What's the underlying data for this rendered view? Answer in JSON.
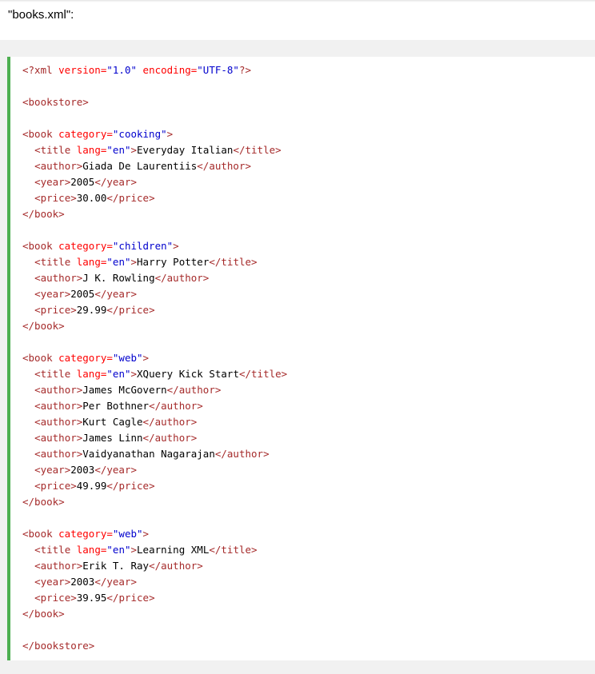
{
  "caption": "\"books.xml\":",
  "colors": {
    "tag": "#a52a2a",
    "attribute": "#ff0000",
    "value": "#0000cd",
    "accent_border": "#4caf50",
    "band": "#f1f1f1"
  },
  "code_lines": [
    [
      [
        "tag",
        "<?xml "
      ],
      [
        "attr",
        "version="
      ],
      [
        "val",
        "\"1.0\""
      ],
      [
        "attr",
        " encoding="
      ],
      [
        "val",
        "\"UTF-8\""
      ],
      [
        "tag",
        "?>"
      ]
    ],
    [],
    [
      [
        "tag",
        "<bookstore>"
      ]
    ],
    [],
    [
      [
        "tag",
        "<book "
      ],
      [
        "attr",
        "category="
      ],
      [
        "val",
        "\"cooking\""
      ],
      [
        "tag",
        ">"
      ]
    ],
    [
      [
        "txt",
        "  "
      ],
      [
        "tag",
        "<title "
      ],
      [
        "attr",
        "lang="
      ],
      [
        "val",
        "\"en\""
      ],
      [
        "tag",
        ">"
      ],
      [
        "txt",
        "Everyday Italian"
      ],
      [
        "tag",
        "</title>"
      ]
    ],
    [
      [
        "txt",
        "  "
      ],
      [
        "tag",
        "<author>"
      ],
      [
        "txt",
        "Giada De Laurentiis"
      ],
      [
        "tag",
        "</author>"
      ]
    ],
    [
      [
        "txt",
        "  "
      ],
      [
        "tag",
        "<year>"
      ],
      [
        "txt",
        "2005"
      ],
      [
        "tag",
        "</year>"
      ]
    ],
    [
      [
        "txt",
        "  "
      ],
      [
        "tag",
        "<price>"
      ],
      [
        "txt",
        "30.00"
      ],
      [
        "tag",
        "</price>"
      ]
    ],
    [
      [
        "tag",
        "</book>"
      ]
    ],
    [],
    [
      [
        "tag",
        "<book "
      ],
      [
        "attr",
        "category="
      ],
      [
        "val",
        "\"children\""
      ],
      [
        "tag",
        ">"
      ]
    ],
    [
      [
        "txt",
        "  "
      ],
      [
        "tag",
        "<title "
      ],
      [
        "attr",
        "lang="
      ],
      [
        "val",
        "\"en\""
      ],
      [
        "tag",
        ">"
      ],
      [
        "txt",
        "Harry Potter"
      ],
      [
        "tag",
        "</title>"
      ]
    ],
    [
      [
        "txt",
        "  "
      ],
      [
        "tag",
        "<author>"
      ],
      [
        "txt",
        "J K. Rowling"
      ],
      [
        "tag",
        "</author>"
      ]
    ],
    [
      [
        "txt",
        "  "
      ],
      [
        "tag",
        "<year>"
      ],
      [
        "txt",
        "2005"
      ],
      [
        "tag",
        "</year>"
      ]
    ],
    [
      [
        "txt",
        "  "
      ],
      [
        "tag",
        "<price>"
      ],
      [
        "txt",
        "29.99"
      ],
      [
        "tag",
        "</price>"
      ]
    ],
    [
      [
        "tag",
        "</book>"
      ]
    ],
    [],
    [
      [
        "tag",
        "<book "
      ],
      [
        "attr",
        "category="
      ],
      [
        "val",
        "\"web\""
      ],
      [
        "tag",
        ">"
      ]
    ],
    [
      [
        "txt",
        "  "
      ],
      [
        "tag",
        "<title "
      ],
      [
        "attr",
        "lang="
      ],
      [
        "val",
        "\"en\""
      ],
      [
        "tag",
        ">"
      ],
      [
        "txt",
        "XQuery Kick Start"
      ],
      [
        "tag",
        "</title>"
      ]
    ],
    [
      [
        "txt",
        "  "
      ],
      [
        "tag",
        "<author>"
      ],
      [
        "txt",
        "James McGovern"
      ],
      [
        "tag",
        "</author>"
      ]
    ],
    [
      [
        "txt",
        "  "
      ],
      [
        "tag",
        "<author>"
      ],
      [
        "txt",
        "Per Bothner"
      ],
      [
        "tag",
        "</author>"
      ]
    ],
    [
      [
        "txt",
        "  "
      ],
      [
        "tag",
        "<author>"
      ],
      [
        "txt",
        "Kurt Cagle"
      ],
      [
        "tag",
        "</author>"
      ]
    ],
    [
      [
        "txt",
        "  "
      ],
      [
        "tag",
        "<author>"
      ],
      [
        "txt",
        "James Linn"
      ],
      [
        "tag",
        "</author>"
      ]
    ],
    [
      [
        "txt",
        "  "
      ],
      [
        "tag",
        "<author>"
      ],
      [
        "txt",
        "Vaidyanathan Nagarajan"
      ],
      [
        "tag",
        "</author>"
      ]
    ],
    [
      [
        "txt",
        "  "
      ],
      [
        "tag",
        "<year>"
      ],
      [
        "txt",
        "2003"
      ],
      [
        "tag",
        "</year>"
      ]
    ],
    [
      [
        "txt",
        "  "
      ],
      [
        "tag",
        "<price>"
      ],
      [
        "txt",
        "49.99"
      ],
      [
        "tag",
        "</price>"
      ]
    ],
    [
      [
        "tag",
        "</book>"
      ]
    ],
    [],
    [
      [
        "tag",
        "<book "
      ],
      [
        "attr",
        "category="
      ],
      [
        "val",
        "\"web\""
      ],
      [
        "tag",
        ">"
      ]
    ],
    [
      [
        "txt",
        "  "
      ],
      [
        "tag",
        "<title "
      ],
      [
        "attr",
        "lang="
      ],
      [
        "val",
        "\"en\""
      ],
      [
        "tag",
        ">"
      ],
      [
        "txt",
        "Learning XML"
      ],
      [
        "tag",
        "</title>"
      ]
    ],
    [
      [
        "txt",
        "  "
      ],
      [
        "tag",
        "<author>"
      ],
      [
        "txt",
        "Erik T. Ray"
      ],
      [
        "tag",
        "</author>"
      ]
    ],
    [
      [
        "txt",
        "  "
      ],
      [
        "tag",
        "<year>"
      ],
      [
        "txt",
        "2003"
      ],
      [
        "tag",
        "</year>"
      ]
    ],
    [
      [
        "txt",
        "  "
      ],
      [
        "tag",
        "<price>"
      ],
      [
        "txt",
        "39.95"
      ],
      [
        "tag",
        "</price>"
      ]
    ],
    [
      [
        "tag",
        "</book>"
      ]
    ],
    [],
    [
      [
        "tag",
        "</bookstore>"
      ]
    ]
  ]
}
